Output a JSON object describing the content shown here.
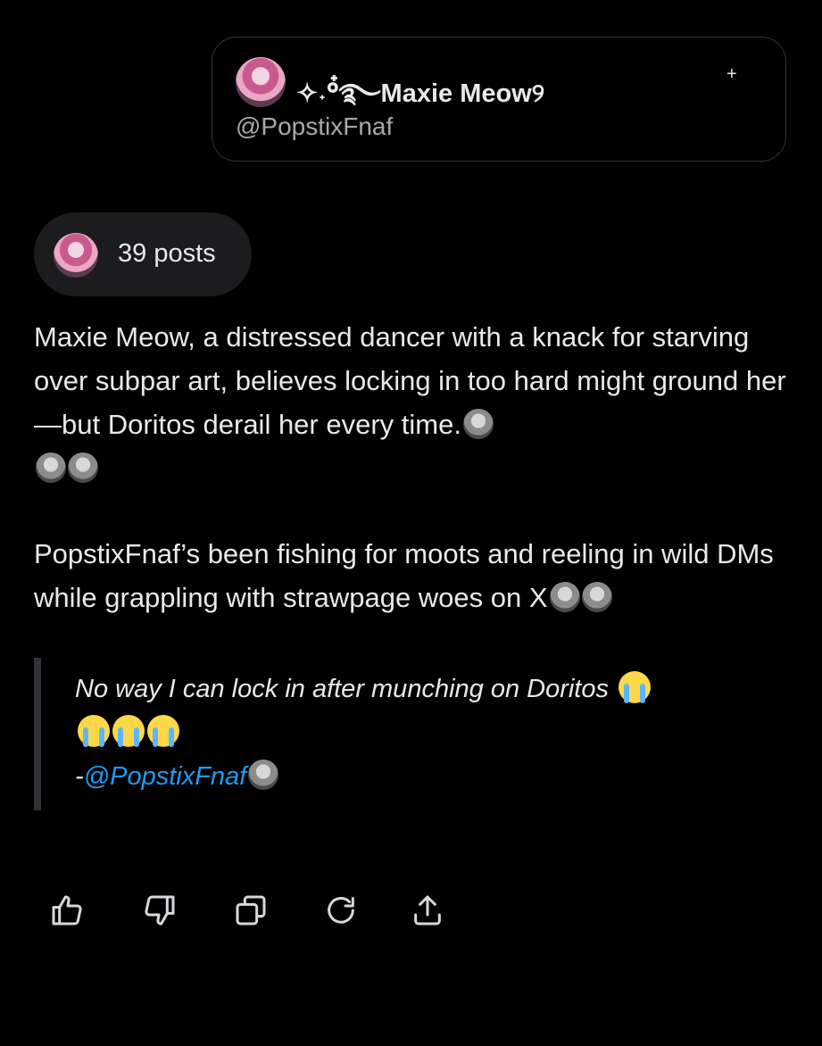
{
  "profile": {
    "display_name": "✧˖°๋࿐Maxie Meow୨",
    "handle": "@PopstixFnaf",
    "plus_symbol": "+"
  },
  "posts_chip": {
    "label": "39 posts"
  },
  "paragraph1": "Maxie Meow, a distressed dancer with a knack for starving over subpar art, believes locking in too hard might ground her—but Doritos derail her every time.",
  "paragraph2": "PopstixFnaf’s been fishing for moots and reeling in wild DMs while grappling with strawpage woes on X",
  "quote": {
    "text": "No way I can lock in after munching on Doritos",
    "dash": "-",
    "link": "@PopstixFnaf"
  },
  "actions": [
    "thumbs-up-icon",
    "thumbs-down-icon",
    "copy-icon",
    "refresh-icon",
    "share-icon"
  ]
}
